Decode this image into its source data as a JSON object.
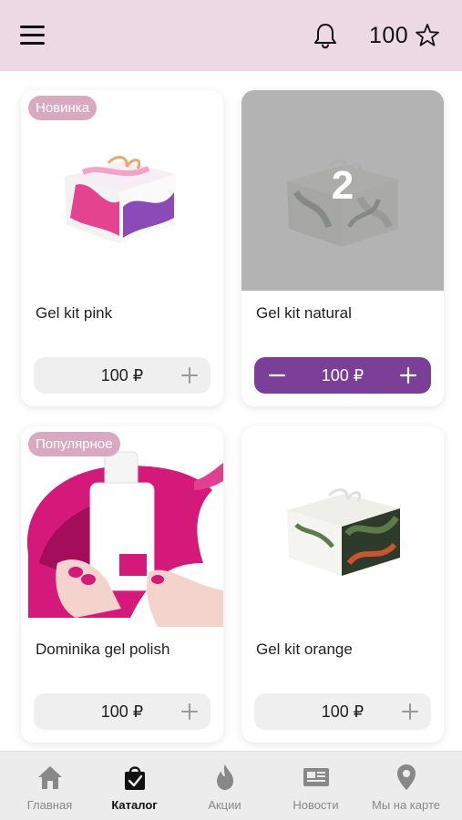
{
  "header": {
    "menu_icon": "hamburger-menu-icon",
    "notification_icon": "bell-icon",
    "points": "100",
    "points_icon": "star-outline-icon"
  },
  "products": [
    {
      "name": "Gel kit pink",
      "price": "100 ₽",
      "badge": "Новинка",
      "in_cart": false,
      "quantity": null,
      "colors": [
        "#e4438f",
        "#8a4bb8",
        "#f2a3c6"
      ]
    },
    {
      "name": "Gel kit natural",
      "price": "100 ₽",
      "badge": "",
      "in_cart": true,
      "quantity": "2",
      "colors": [
        "#5e6b58",
        "#9aa890",
        "#dcdcd6"
      ]
    },
    {
      "name": "Dominika gel polish",
      "price": "100 ₽",
      "badge": "Популярное",
      "in_cart": false,
      "quantity": null,
      "colors": [
        "#d4197a",
        "#f4d3cc",
        "#ffffff"
      ]
    },
    {
      "name": "Gel kit orange",
      "price": "100 ₽",
      "badge": "",
      "in_cart": false,
      "quantity": null,
      "colors": [
        "#2e3a2a",
        "#c9542f",
        "#5d7b4a"
      ]
    }
  ],
  "tabs": [
    {
      "label": "Главная",
      "icon": "home-icon",
      "active": false
    },
    {
      "label": "Каталог",
      "icon": "shopping-bag-icon",
      "active": true
    },
    {
      "label": "Акции",
      "icon": "flame-icon",
      "active": false
    },
    {
      "label": "Новости",
      "icon": "newspaper-icon",
      "active": false
    },
    {
      "label": "Мы на карте",
      "icon": "map-pin-icon",
      "active": false
    }
  ],
  "colors": {
    "header_bg": "#ecd9e3",
    "accent": "#7b3f98",
    "badge_bg": "#d9a9c2",
    "tabbar_bg": "#ececec"
  }
}
